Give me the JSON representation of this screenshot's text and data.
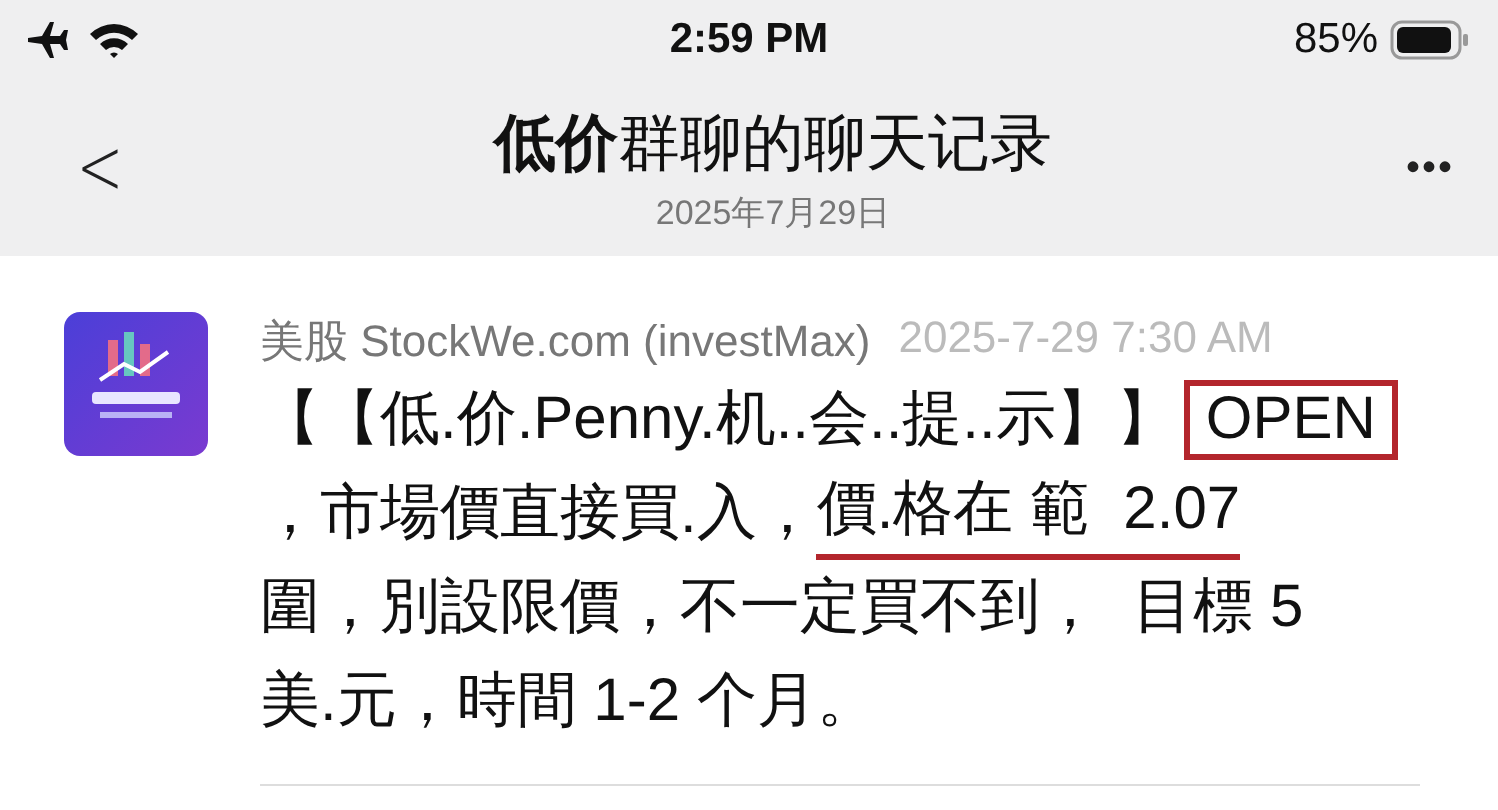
{
  "status_bar": {
    "time": "2:59 PM",
    "battery": "85%"
  },
  "nav": {
    "back": "<",
    "title": "**低价**群聊的聊天记录",
    "subtitle": "2025年7月29日",
    "more": "•••"
  },
  "message": {
    "sender": "美股 StockWe.com (investMax)",
    "time": "2025-7-29 7:30 AM",
    "lines": [
      [
        {
          "text": "【【低.价.Penny.机..会..提..示】】",
          "kind": "plain"
        },
        {
          "text": "OPEN",
          "kind": "boxed"
        }
      ],
      [
        {
          "text": "，市場價直接買.入，",
          "kind": "plain"
        },
        {
          "text": "價.格在 範  2.07",
          "kind": "underlined"
        }
      ],
      [
        {
          "text": "圍，別設限價，不一定買不到，  目標 5",
          "kind": "plain"
        }
      ],
      [
        {
          "text": "美.元，時間 1-2 个月。",
          "kind": "plain"
        }
      ]
    ]
  }
}
